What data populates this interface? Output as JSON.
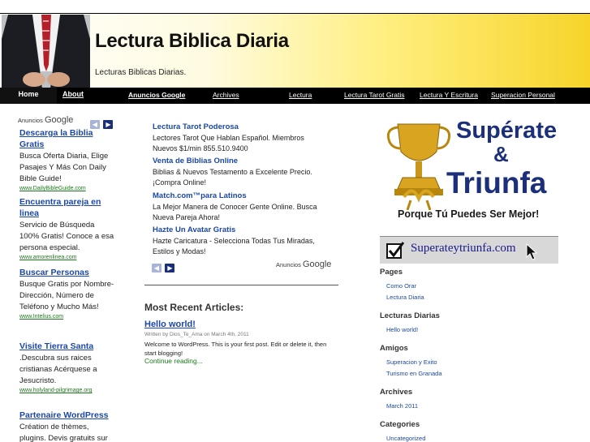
{
  "header": {
    "title": "Lectura Biblica Diaria",
    "description": "Lecturas Biblicas Diarias."
  },
  "nav": {
    "home": "Home",
    "about": "About",
    "ads_title": "Anuncios Google",
    "ads": [
      "Archives",
      "Lectura",
      "Lectura Tarot Gratis",
      "Lectura Y Escritura",
      "Superacion Personal"
    ]
  },
  "left_ads": {
    "label_prefix": "Anuncios",
    "label_brand": "Google",
    "items": [
      {
        "title": "Descarga la Biblia Gratis",
        "desc": "Busca Oferta Diaria, Elige Pasajes Y Más Con Daily Bible Guide!",
        "url": "www.DailyBibleGuide.com"
      },
      {
        "title": "Encuentra pareja en linea",
        "desc": "Servicio de Búsqueda 100% Gratis! Conoce a esa persona especial.",
        "url": "www.amorenlinea.com"
      },
      {
        "title": "Buscar Personas",
        "desc": "Busque Gratis por Nombre-Dirección, Número de Teléfono y Mucho Más!",
        "url": "www.Intelius.com"
      },
      {
        "title": "Visite Tierra Santa",
        "desc": ".Descubra sus raices cristianas Acérquese a Jesucristo.",
        "url": "www.holyland-pilgrimage.org"
      },
      {
        "title": "Partenaire WordPress",
        "desc": "Création de thèmes, plugins. Devis gratuits sur",
        "url": ""
      }
    ]
  },
  "center_ads": {
    "label_prefix": "Anuncios",
    "label_brand": "Google",
    "items": [
      {
        "title": "Lectura Tarot Poderosa",
        "desc": "Lectores Tarot Que Hablan Español. Miembros Nuevos $1/min 855.510.9400"
      },
      {
        "title": "Venta de Biblias Online",
        "desc": "Biblias & Nuevos Testamento a Excelente Precio. ¡Compra Online!"
      },
      {
        "title": "Match.com™para Latinos",
        "desc": "La Mejor Manera de Conocer Gente Online. Busca Nueva Pareja Ahora!"
      },
      {
        "title": "Hazte Un Avatar Gratis",
        "desc": "Hazte Caricatura - Selecciona Todas Tus Miradas, Estilos y Modas!"
      }
    ]
  },
  "main": {
    "recent_heading": "Most Recent Articles:",
    "post_title": "Hello world!",
    "post_meta": "Written by Dios_Te_Ama on March 4th, 2011",
    "post_body": "Welcome to WordPress. This is your first post. Edit or delete it, then start blogging!",
    "post_more": "Continue reading..."
  },
  "banner": {
    "word1": "Supérate",
    "amp": "&",
    "word2": "Triunfa",
    "tagline": "Porque Tú Puedes Ser Mejor!",
    "url": "Superateytriunfa.com",
    "colors": {
      "text": "#1b2f7a",
      "trophy": "#d9a520"
    }
  },
  "sidebar": {
    "pages_heading": "Pages",
    "pages": [
      "Como Orar",
      "Lectura Diaria"
    ],
    "lecturas_heading": "Lecturas Diarias",
    "lecturas": [
      "Hello world!"
    ],
    "amigos_heading": "Amigos",
    "amigos": [
      "Superacion y Exito",
      "Turismo en Granada"
    ],
    "archives_heading": "Archives",
    "archives": [
      "March 2011"
    ],
    "categories_heading": "Categories",
    "categories": [
      "Uncategorized"
    ]
  }
}
